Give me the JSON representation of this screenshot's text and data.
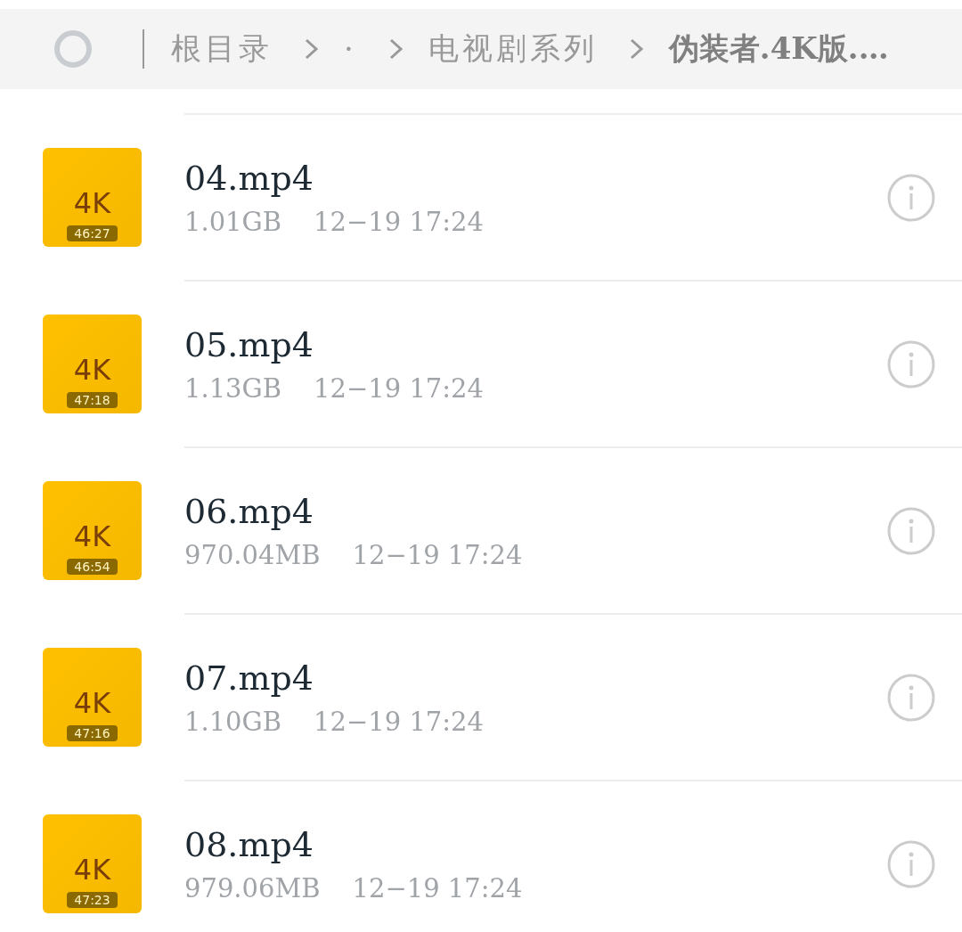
{
  "breadcrumb": {
    "select_all": {
      "checked": false
    },
    "items": [
      {
        "label": "根目录",
        "current": false
      },
      {
        "label": "·",
        "current": false
      },
      {
        "label": "电视剧系列",
        "current": false
      },
      {
        "label": "伪装者.4K版.…",
        "current": true
      }
    ]
  },
  "files": [
    {
      "name": "04.mp4",
      "size": "1.01GB",
      "date": "12−19 17:24",
      "badge": "4K",
      "duration": "46:27"
    },
    {
      "name": "05.mp4",
      "size": "1.13GB",
      "date": "12−19 17:24",
      "badge": "4K",
      "duration": "47:18"
    },
    {
      "name": "06.mp4",
      "size": "970.04MB",
      "date": "12−19 17:24",
      "badge": "4K",
      "duration": "46:54"
    },
    {
      "name": "07.mp4",
      "size": "1.10GB",
      "date": "12−19 17:24",
      "badge": "4K",
      "duration": "47:16"
    },
    {
      "name": "08.mp4",
      "size": "979.06MB",
      "date": "12−19 17:24",
      "badge": "4K",
      "duration": "47:23"
    }
  ]
}
